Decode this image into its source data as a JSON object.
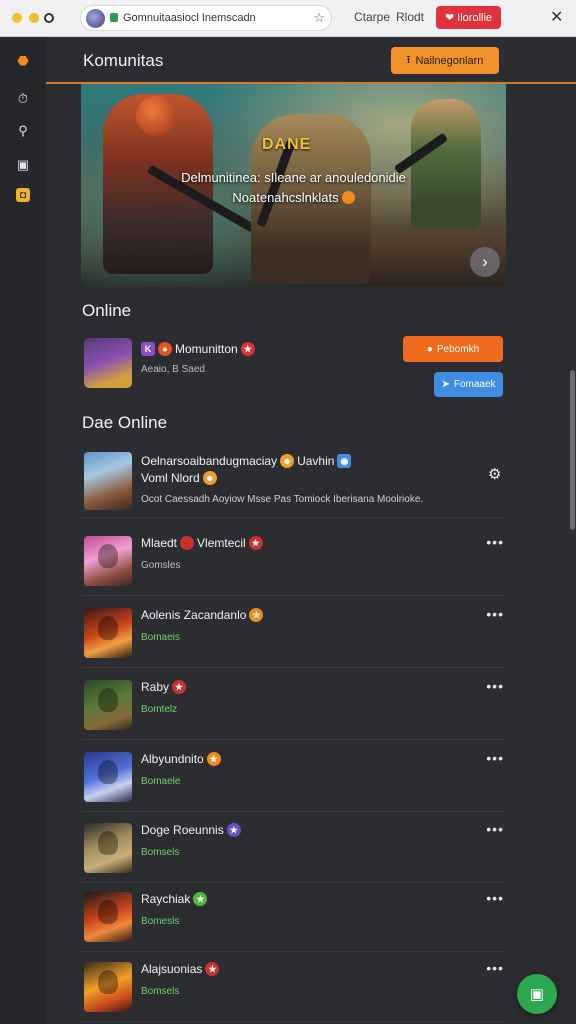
{
  "browser": {
    "url": "Gomnuitaasiocl Inemscadn",
    "link1": "Ctarpe",
    "link2": "Rlodt",
    "cta": "Ilorollie"
  },
  "header": {
    "title": "Komunitas",
    "cta": "Nailnegonlarn"
  },
  "hero": {
    "badge": "DANE",
    "line1": "Delmunitinea: sIleane ar anouledonidie",
    "line2": "Noatenahcslnklats"
  },
  "online": {
    "title": "Online",
    "user": {
      "name": "Momunitton",
      "sub": "Aeaio, B Saed"
    },
    "primary_button": "Pebomkh",
    "secondary_button": "Fomaaek"
  },
  "dae_online": {
    "title": "Dae Online",
    "first": {
      "name_line1": "Oelnarsoaibandugmaciay",
      "name_tag": "Uavhin",
      "name_line2": "Voml Nlord",
      "desc": "Ocot Caessadh Aoyiow Msse Pas Tomiock Iberisana Moolrioke."
    },
    "items": [
      {
        "name": "Mlaedt",
        "tag": "Vlemtecil",
        "sub": "Gomsles",
        "accent": "#c8322a"
      },
      {
        "name": "Aolenis Zacandanlo",
        "tag": "",
        "sub": "Bomaeis",
        "accent": "#f08a1c"
      },
      {
        "name": "Raby",
        "tag": "",
        "sub": "Bomtelz",
        "accent": "#c8322a"
      },
      {
        "name": "Albyundnito",
        "tag": "",
        "sub": "Bomaele",
        "accent": "#f08a1c"
      },
      {
        "name": "Doge Roeunnis",
        "tag": "",
        "sub": "Bomsels",
        "accent": "#6a4fc8"
      },
      {
        "name": "Raychiak",
        "tag": "",
        "sub": "Bomesls",
        "accent": "#4fb840"
      },
      {
        "name": "Alajsuonias",
        "tag": "",
        "sub": "Bomsels",
        "accent": "#c8322a"
      }
    ]
  },
  "colors": {
    "accent_orange": "#f06a1d",
    "header_cta": "#f0932a",
    "blue": "#3f8ee4",
    "online_green": "#6fd26a",
    "background": "#2b2d31"
  }
}
